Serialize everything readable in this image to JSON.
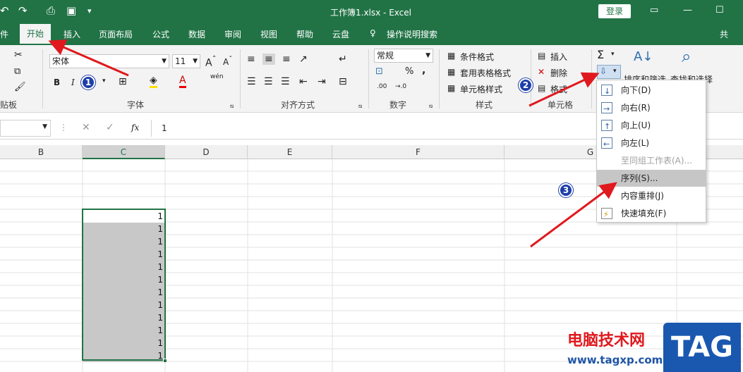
{
  "titlebar": {
    "title": "工作簿1.xlsx  -  Excel",
    "login": "登录"
  },
  "tabs": [
    "件",
    "开始",
    "插入",
    "页面布局",
    "公式",
    "数据",
    "审阅",
    "视图",
    "帮助",
    "云盘",
    "操作说明搜索",
    "共"
  ],
  "ribbon": {
    "font_name": "宋体",
    "font_size": "11",
    "bold": "B",
    "italic": "I",
    "phonetic": "wén",
    "number_format": "常规",
    "percent": "%",
    "comma": ",",
    "dec_inc": ".00",
    "styles": [
      "条件格式",
      "套用表格格式",
      "单元格样式"
    ],
    "cells": [
      "插入",
      "删除",
      "格式"
    ],
    "sort_filter": "排序和筛选",
    "find_select": "查找和选择",
    "groups": {
      "clipboard": "贴板",
      "font": "字体",
      "align": "对齐方式",
      "number": "数字",
      "styles": "样式",
      "cells": "单元格"
    }
  },
  "formula": {
    "fx": "fx",
    "value": "1"
  },
  "columns": [
    "B",
    "C",
    "D",
    "E",
    "F",
    "G"
  ],
  "cell_values": [
    "1",
    "1",
    "1",
    "1",
    "1",
    "1",
    "1",
    "1",
    "1",
    "1",
    "1",
    "1"
  ],
  "fill_menu": [
    {
      "label": "向下(D)",
      "enabled": true
    },
    {
      "label": "向右(R)",
      "enabled": true
    },
    {
      "label": "向上(U)",
      "enabled": true
    },
    {
      "label": "向左(L)",
      "enabled": true
    },
    {
      "label": "至同组工作表(A)...",
      "enabled": false
    },
    {
      "label": "序列(S)...",
      "enabled": true
    },
    {
      "label": "内容重排(J)",
      "enabled": true
    },
    {
      "label": "快速填充(F)",
      "enabled": true
    }
  ],
  "badges": [
    "1",
    "2",
    "3"
  ],
  "watermark": {
    "main": "电脑技术网",
    "url": "www.tagxp.com",
    "logo": "TAG"
  },
  "colors": {
    "excel_green": "#217346",
    "arrow_red": "#e0191e",
    "badge_blue": "#1e3fa8"
  }
}
